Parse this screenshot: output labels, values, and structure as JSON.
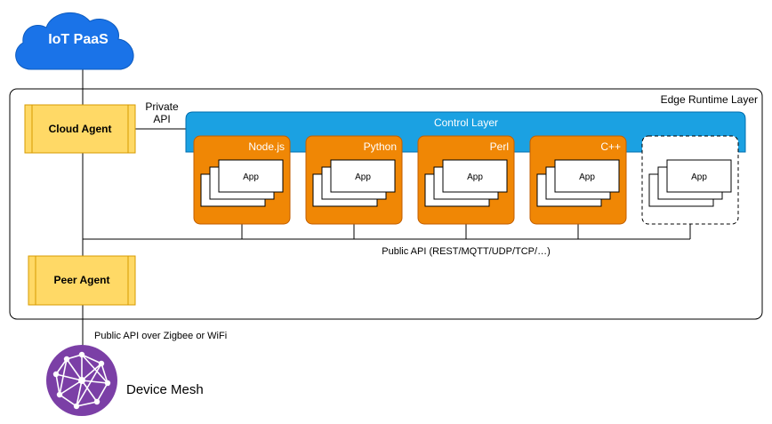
{
  "cloud": {
    "label": "IoT PaaS",
    "icon": "cloud-icon",
    "color": "#1a73e8"
  },
  "edge_layer": {
    "label": "Edge Runtime Layer"
  },
  "cloud_agent": {
    "label": "Cloud Agent"
  },
  "peer_agent": {
    "label": "Peer Agent"
  },
  "private_api": {
    "line1": "Private",
    "line2": "API"
  },
  "control_layer": {
    "label": "Control Layer",
    "color": "#1ba1e2"
  },
  "runtimes": [
    {
      "label": "Node.js",
      "app_label": "App",
      "color": "#f08705"
    },
    {
      "label": "Python",
      "app_label": "App",
      "color": "#f08705"
    },
    {
      "label": "Perl",
      "app_label": "App",
      "color": "#f08705"
    },
    {
      "label": "C++",
      "app_label": "App",
      "color": "#f08705"
    },
    {
      "label": "",
      "app_label": "App",
      "color": "#ffffff"
    }
  ],
  "public_api": {
    "label": "Public API (REST/MQTT/UDP/TCP/…)"
  },
  "mesh_api": {
    "label": "Public API over Zigbee or WiFi"
  },
  "device_mesh": {
    "label": "Device Mesh",
    "icon": "mesh-network-icon",
    "color": "#7b3fa6"
  },
  "colors": {
    "agent_fill": "#ffd966",
    "agent_stroke": "#d79b00"
  }
}
